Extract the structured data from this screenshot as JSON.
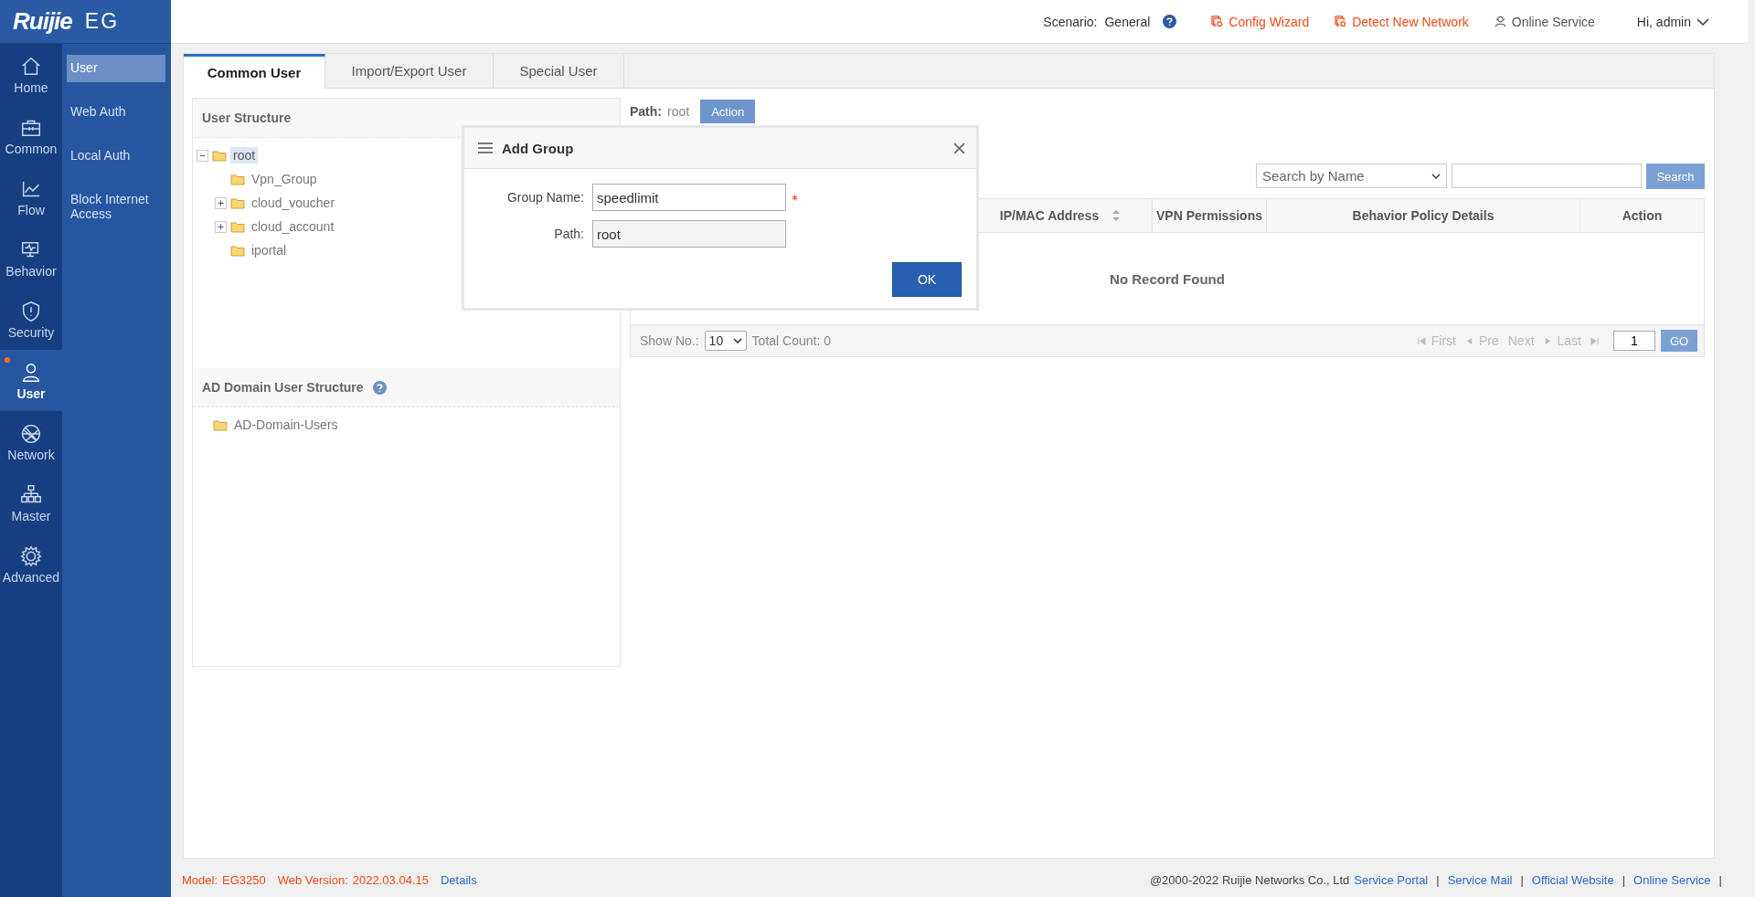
{
  "brand": {
    "logo": "Ruijie",
    "product": "EG"
  },
  "nav_rail": [
    {
      "label": "Home",
      "selected": false,
      "alert": false
    },
    {
      "label": "Common",
      "selected": false,
      "alert": false
    },
    {
      "label": "Flow",
      "selected": false,
      "alert": false
    },
    {
      "label": "Behavior",
      "selected": false,
      "alert": false
    },
    {
      "label": "Security",
      "selected": false,
      "alert": false
    },
    {
      "label": "User",
      "selected": true,
      "alert": true
    },
    {
      "label": "Network",
      "selected": false,
      "alert": false
    },
    {
      "label": "Master",
      "selected": false,
      "alert": false
    },
    {
      "label": "Advanced",
      "selected": false,
      "alert": false
    }
  ],
  "submenu": [
    {
      "label": "User",
      "selected": true
    },
    {
      "label": "Web Auth",
      "selected": false
    },
    {
      "label": "Local Auth",
      "selected": false
    },
    {
      "label": "Block Internet Access",
      "selected": false
    }
  ],
  "top_bar": {
    "scenario_label": "Scenario:",
    "scenario": "General",
    "links": [
      {
        "label": "Config Wizard",
        "kind": "alert"
      },
      {
        "label": "Detect New Network",
        "kind": "alert"
      },
      {
        "label": "Online Service",
        "kind": "service"
      }
    ],
    "user": "Hi, admin"
  },
  "tabs": [
    {
      "label": "Common User",
      "selected": true
    },
    {
      "label": "Import/Export User",
      "selected": false
    },
    {
      "label": "Special User",
      "selected": false
    }
  ],
  "user_structure": {
    "title": "User Structure",
    "tree": [
      {
        "label": "root",
        "expanded": true,
        "selected": true,
        "children": [
          {
            "label": "Vpn_Group",
            "selected": false
          },
          {
            "label": "cloud_voucher",
            "expanded": false,
            "selected": false
          },
          {
            "label": "cloud_account",
            "expanded": false,
            "selected": false
          },
          {
            "label": "iportal",
            "selected": false
          }
        ]
      }
    ]
  },
  "ad_structure": {
    "title": "AD Domain User Structure",
    "tree": [
      {
        "label": "AD-Domain-Users",
        "selected": false
      }
    ]
  },
  "path": {
    "label": "Path:",
    "value": "root",
    "action": "Action"
  },
  "search": {
    "field": "Search by Name",
    "button": "Search"
  },
  "table": {
    "columns": [
      {
        "label": "IP/MAC Address",
        "sortable": true
      },
      {
        "label": "VPN Permissions",
        "sortable": false
      },
      {
        "label": "Behavior Policy Details",
        "sortable": false
      },
      {
        "label": "Action",
        "sortable": false
      }
    ],
    "empty_text": "No Record Found"
  },
  "pager": {
    "show_label": "Show No.:",
    "page_size": "10",
    "total": "Total Count: 0",
    "first": "First",
    "pre": "Pre",
    "next": "Next",
    "last": "Last",
    "page": "1",
    "go": "GO"
  },
  "dialog": {
    "title": "Add Group",
    "fields": [
      {
        "label": "Group Name:",
        "value": "speedlimit",
        "required": true
      },
      {
        "label": "Path:",
        "value": "root",
        "required": false
      }
    ],
    "ok": "OK"
  },
  "footer": {
    "model_label": "Model:",
    "model": "EG3250",
    "version_label": "Web Version:",
    "version": "2022.03.04.15",
    "details": "Details",
    "copyright": "@2000-2022 Ruijie Networks Co., Ltd",
    "separator": "|",
    "links": [
      "Service Portal",
      "Service Mail",
      "Official Website",
      "Online Service"
    ]
  }
}
